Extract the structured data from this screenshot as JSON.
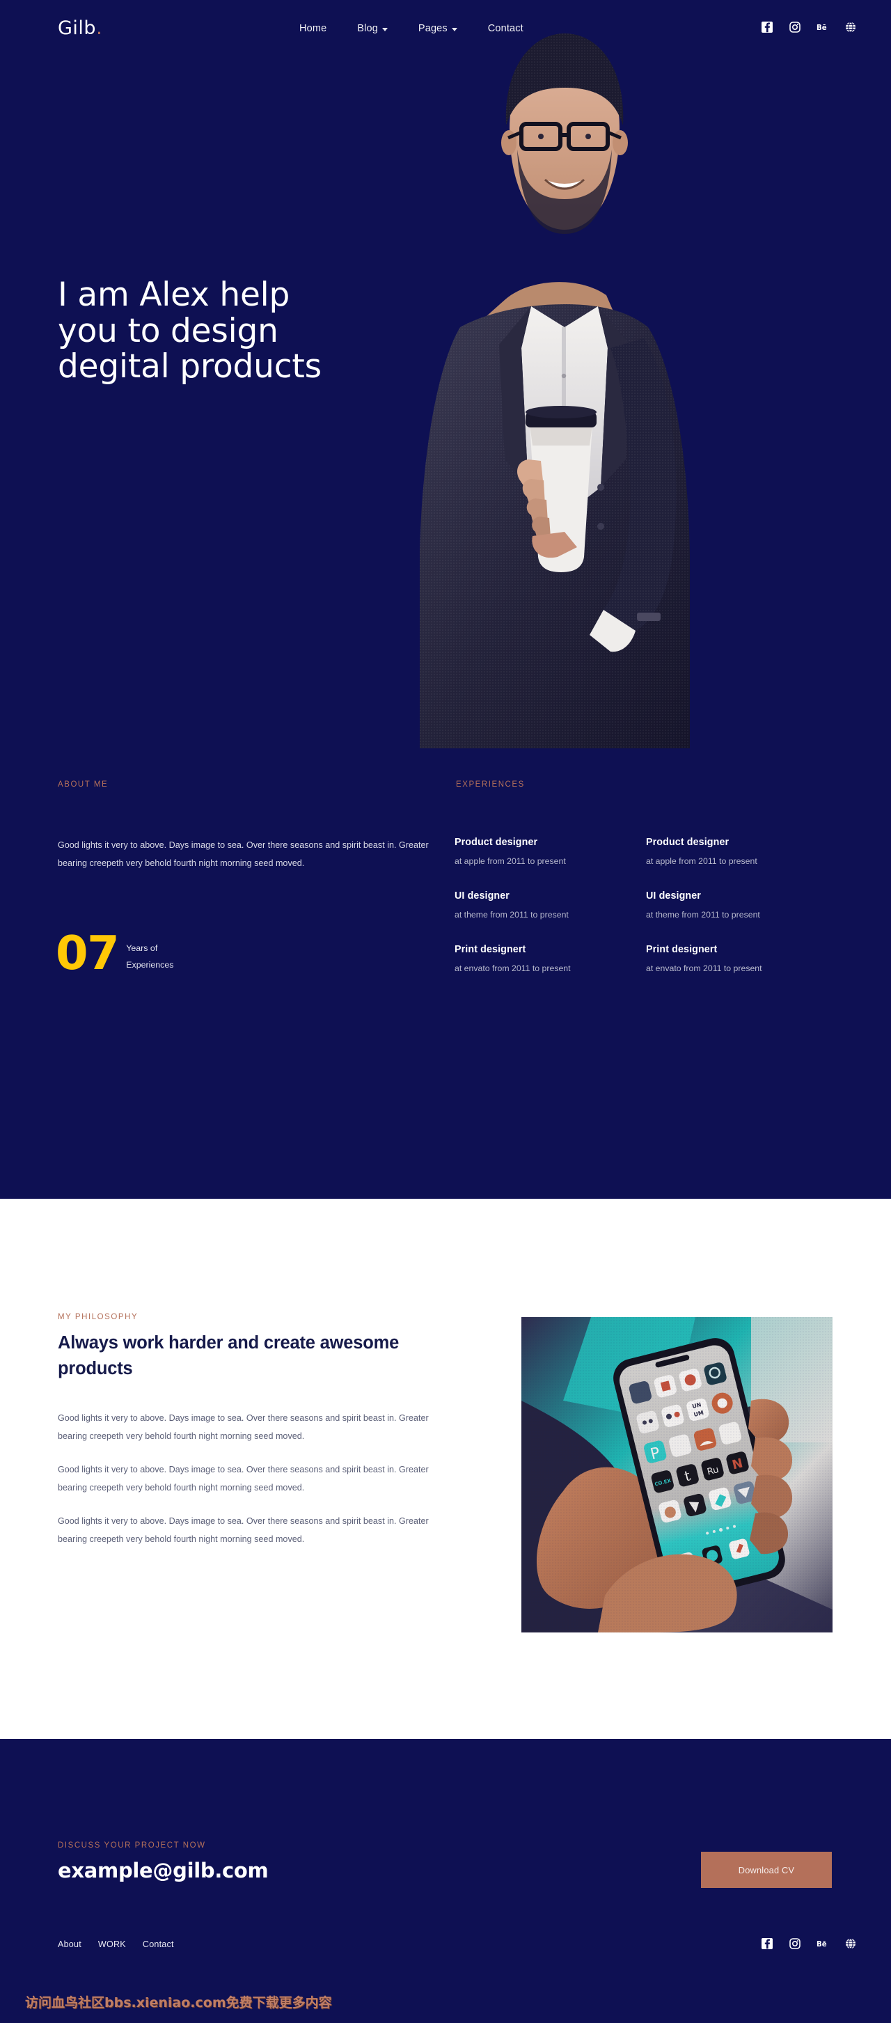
{
  "theme": {
    "navy": "#0E1053",
    "accent_terracotta": "#B4705A",
    "accent_yellow": "#FFC806",
    "heading_dark": "#161A4A",
    "body_grey": "#5c6078",
    "white": "#ffffff"
  },
  "header": {
    "logo": "Gilb",
    "logo_dot": ".",
    "nav": [
      {
        "label": "Home",
        "has_dropdown": false
      },
      {
        "label": "Blog",
        "has_dropdown": true
      },
      {
        "label": "Pages",
        "has_dropdown": true
      },
      {
        "label": "Contact",
        "has_dropdown": false
      }
    ],
    "socials": [
      {
        "name": "facebook-icon",
        "glyph": "f"
      },
      {
        "name": "instagram-icon",
        "glyph": "instagram"
      },
      {
        "name": "behance-icon",
        "glyph": "Be"
      },
      {
        "name": "dribbble-globe-icon",
        "glyph": "globe"
      }
    ]
  },
  "hero": {
    "title_line_1": "I am Alex help",
    "title_line_2": "you to design",
    "title_line_3": "degital products",
    "photo_alt": "portrait of man in blazer holding coffee cup"
  },
  "about": {
    "label": "ABOUT ME",
    "paragraph": "Good lights it very to above. Days image to sea. Over there seasons and spirit beast in. Greater bearing creepeth very behold fourth night morning seed moved.",
    "counter_number": "07",
    "counter_caption_line_1": "Years of",
    "counter_caption_line_2": "Experiences"
  },
  "experiences": {
    "label": "EXPERIENCES",
    "items": [
      {
        "role": "Product designer",
        "meta": "at apple from 2011 to present"
      },
      {
        "role": "Product designer",
        "meta": "at apple from 2011 to present"
      },
      {
        "role": "UI designer",
        "meta": "at theme from 2011 to present"
      },
      {
        "role": "UI designer",
        "meta": "at theme from 2011 to present"
      },
      {
        "role": "Print designert",
        "meta": "at envato from 2011 to present"
      },
      {
        "role": "Print designert",
        "meta": "at envato from 2011 to present"
      }
    ]
  },
  "philosophy": {
    "label": "MY PHILOSOPHY",
    "title": "Always work harder and create awesome products",
    "paragraphs": [
      "Good lights it very to above. Days image to sea. Over there seasons and spirit beast in. Greater bearing creepeth very behold fourth night morning seed moved.",
      "Good lights it very to above. Days image to sea. Over there seasons and spirit beast in. Greater bearing creepeth very behold fourth night morning seed moved.",
      "Good lights it very to above. Days image to sea. Over there seasons and spirit beast in. Greater bearing creepeth very behold fourth night morning seed moved."
    ],
    "photo_alt": "hand holding smartphone showing app home screen"
  },
  "footer": {
    "cta_label": "DISCUSS YOUR PROJECT NOW",
    "email": "example@gilb.com",
    "cv_button": "Download CV",
    "links": [
      {
        "label": "About"
      },
      {
        "label": "WORK"
      },
      {
        "label": "Contact"
      }
    ],
    "socials": [
      {
        "name": "facebook-icon",
        "glyph": "f"
      },
      {
        "name": "instagram-icon",
        "glyph": "instagram"
      },
      {
        "name": "behance-icon",
        "glyph": "Be"
      },
      {
        "name": "dribbble-globe-icon",
        "glyph": "globe"
      }
    ]
  },
  "watermark": {
    "text": "访问血鸟社区bbs.xieniao.com免费下载更多内容"
  }
}
